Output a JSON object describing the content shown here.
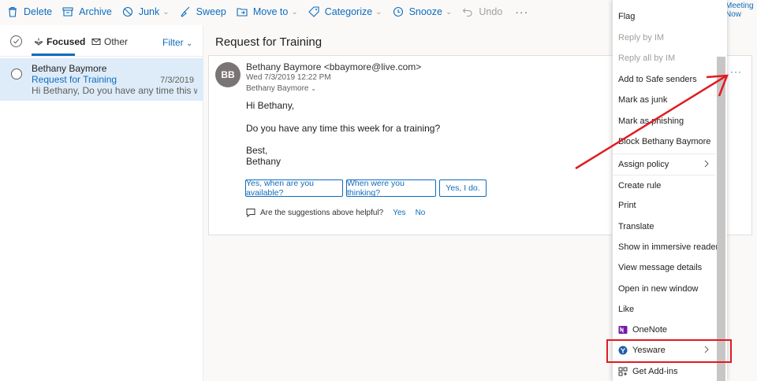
{
  "toolbar": {
    "delete": "Delete",
    "archive": "Archive",
    "junk": "Junk",
    "sweep": "Sweep",
    "move_to": "Move to",
    "categorize": "Categorize",
    "snooze": "Snooze",
    "undo": "Undo",
    "more": "···"
  },
  "meeting": {
    "line1": "Meeting",
    "line2": "Now"
  },
  "list": {
    "pivot_focused": "Focused",
    "pivot_other": "Other",
    "filter": "Filter"
  },
  "mail_item": {
    "from": "Bethany Baymore",
    "subject": "Request for Training",
    "date": "7/3/2019",
    "preview": "Hi Bethany, Do you have any time this week..."
  },
  "reading": {
    "subject": "Request for Training",
    "avatar_initials": "BB",
    "sender": "Bethany Baymore <bbaymore@live.com>",
    "sent": "Wed 7/3/2019 12:22 PM",
    "to": "Bethany Baymore",
    "body": [
      "Hi Bethany,",
      "Do you have any time this week for a training?",
      "Best,",
      "Bethany"
    ],
    "suggestions": [
      "Yes, when are you available?",
      "When were you thinking?",
      "Yes, I do."
    ],
    "helpful_q": "Are the suggestions above helpful?",
    "helpful_yes": "Yes",
    "helpful_no": "No",
    "more": "···"
  },
  "menu": {
    "items": [
      {
        "label": "Flag",
        "disabled": false,
        "submenu": false
      },
      {
        "label": "Reply by IM",
        "disabled": true,
        "submenu": false
      },
      {
        "label": "Reply all by IM",
        "disabled": true,
        "submenu": false
      },
      {
        "label": "Add to Safe senders",
        "disabled": false,
        "submenu": false
      },
      {
        "label": "Mark as junk",
        "disabled": false,
        "submenu": false
      },
      {
        "label": "Mark as phishing",
        "disabled": false,
        "submenu": false
      },
      {
        "label": "Block Bethany Baymore",
        "disabled": false,
        "submenu": false
      },
      {
        "label": "Assign policy",
        "disabled": false,
        "submenu": true
      },
      {
        "label": "Create rule",
        "disabled": false,
        "submenu": false
      },
      {
        "label": "Print",
        "disabled": false,
        "submenu": false
      },
      {
        "label": "Translate",
        "disabled": false,
        "submenu": false
      },
      {
        "label": "Show in immersive reader",
        "disabled": false,
        "submenu": false
      },
      {
        "label": "View message details",
        "disabled": false,
        "submenu": false
      },
      {
        "label": "Open in new window",
        "disabled": false,
        "submenu": false
      },
      {
        "label": "Like",
        "disabled": false,
        "submenu": false
      },
      {
        "label": "OneNote",
        "disabled": false,
        "submenu": false,
        "icon": "onenote-icon"
      },
      {
        "label": "Yesware",
        "disabled": false,
        "submenu": true,
        "icon": "yesware-icon"
      },
      {
        "label": "Get Add-ins",
        "disabled": false,
        "submenu": false,
        "icon": "add-ins-icon"
      }
    ]
  },
  "colors": {
    "accent": "#0f6cbd",
    "selected_bg": "#deecf9",
    "annotation": "#e01b22",
    "onenote": "#7719aa",
    "yesware": "#1f5fa8"
  }
}
